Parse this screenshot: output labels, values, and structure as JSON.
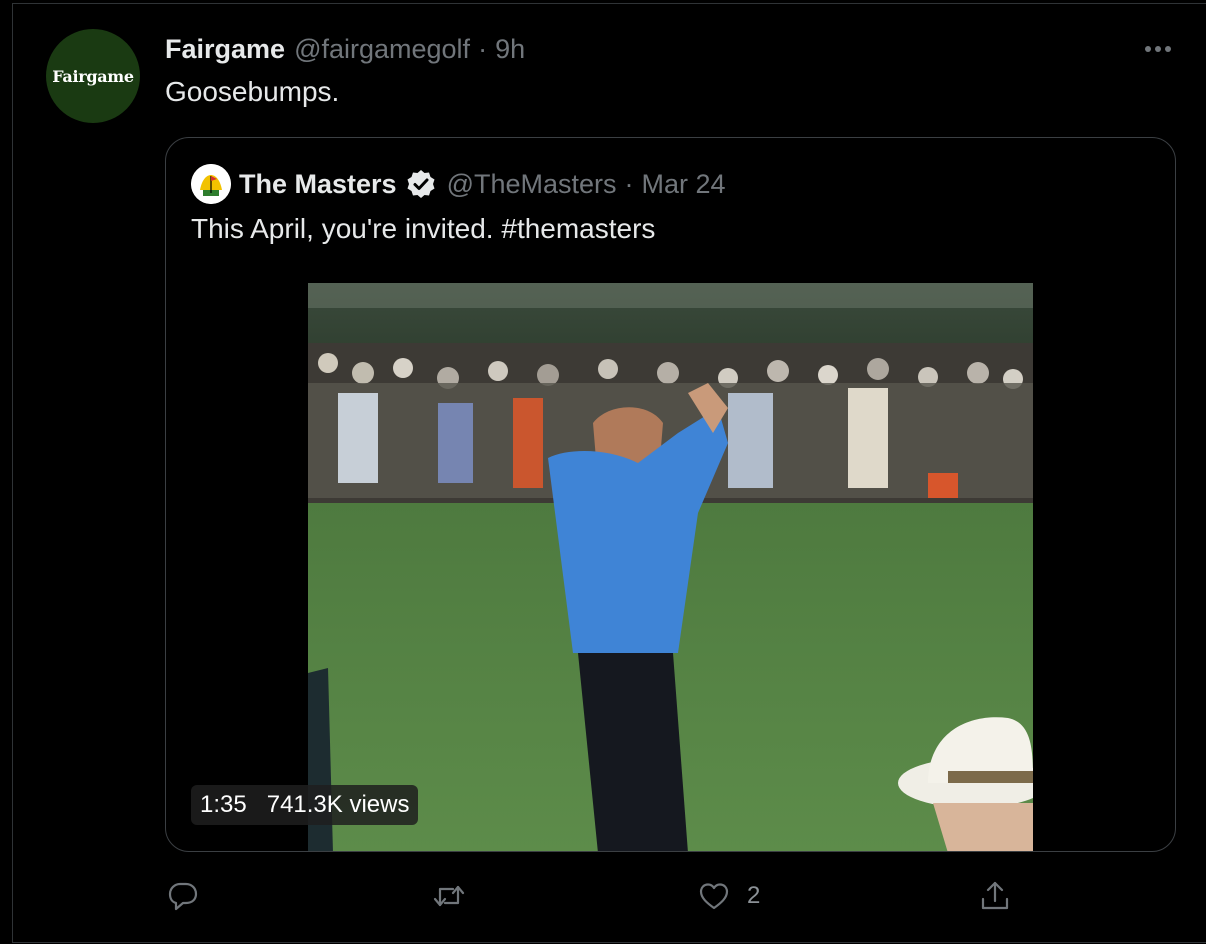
{
  "tweet": {
    "avatar_text": "Fairgame",
    "name": "Fairgame",
    "handle": "@fairgamegolf",
    "separator": "·",
    "time": "9h",
    "text": "Goosebumps."
  },
  "quote": {
    "name": "The Masters",
    "handle": "@TheMasters",
    "separator": "·",
    "date": "Mar 24",
    "text": "This April, you're invited. #themasters",
    "video": {
      "duration": "1:35",
      "views": "741.3K views"
    }
  },
  "actions": {
    "like_count": "2"
  },
  "colors": {
    "background": "#000000",
    "text": "#e7e9ea",
    "muted": "#71767b",
    "border": "#2f3336",
    "avatar_bg": "#1a3a12"
  },
  "icons": [
    "more-icon",
    "verified-badge-icon",
    "reply-icon",
    "retweet-icon",
    "like-icon",
    "share-icon"
  ]
}
